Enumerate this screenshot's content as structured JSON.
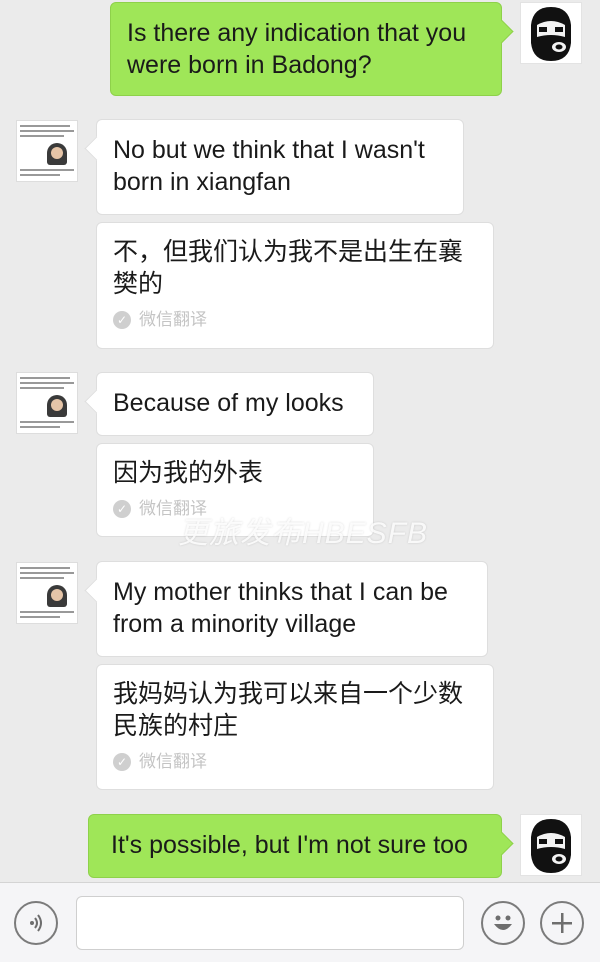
{
  "messages": {
    "m1": {
      "text": "Is there any indication that you were born in Badong?"
    },
    "m2": {
      "text": "No but we think that I wasn't born in xiangfan"
    },
    "m2t": {
      "text": "不，但我们认为我不是出生在襄樊的",
      "tag": "微信翻译"
    },
    "m3": {
      "text": "Because of my looks"
    },
    "m3t": {
      "text": "因为我的外表",
      "tag": "微信翻译"
    },
    "m4": {
      "text": "My mother thinks that I can be from a minority village"
    },
    "m4t": {
      "text": "我妈妈认为我可以来自一个少数民族的村庄",
      "tag": "微信翻译"
    },
    "m5": {
      "text": "It's possible, but I'm not sure too"
    }
  },
  "watermark": "更旅发布HBESFB",
  "colors": {
    "outgoing_bubble": "#9fe658",
    "incoming_bubble": "#ffffff",
    "background": "#ebebeb"
  },
  "icons": {
    "voice": "voice-icon",
    "emoji": "smiley-icon",
    "more": "plus-icon",
    "check": "check-icon"
  }
}
